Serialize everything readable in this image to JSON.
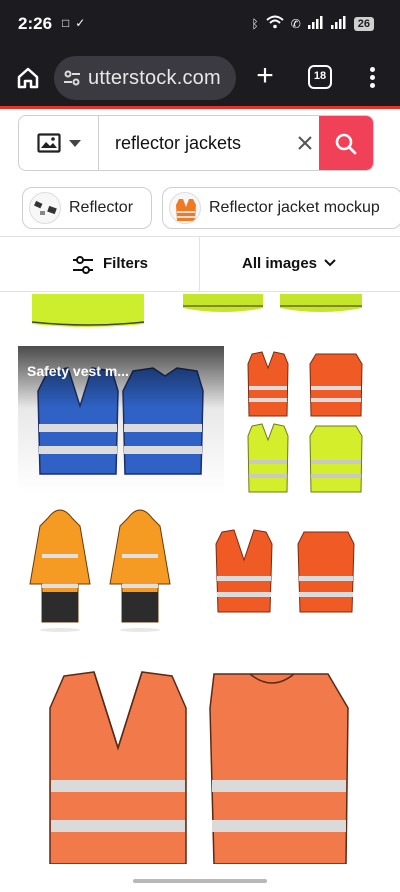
{
  "status_bar": {
    "time": "2:26",
    "left_icons": [
      "sim-card-icon",
      "download-done-icon"
    ],
    "right_icons": [
      "bluetooth-icon",
      "wifi-icon",
      "call-icon",
      "signal-icon",
      "signal-icon"
    ],
    "battery": "26"
  },
  "browser": {
    "url": "utterstock.com",
    "tab_count": "18",
    "accent_color": "#e6332a"
  },
  "search": {
    "query": "reflector jackets",
    "image_type_icon": "image-icon",
    "search_color": "#f04158"
  },
  "chips": [
    {
      "label": "Reflector"
    },
    {
      "label": "Reflector jacket mockup"
    }
  ],
  "filters": {
    "filters_label": "Filters",
    "type_label": "All images"
  },
  "results": [
    {
      "caption": ""
    },
    {
      "caption": "Safety vest m..."
    },
    {
      "caption": ""
    },
    {
      "caption": ""
    },
    {
      "caption": ""
    },
    {
      "caption": ""
    }
  ]
}
